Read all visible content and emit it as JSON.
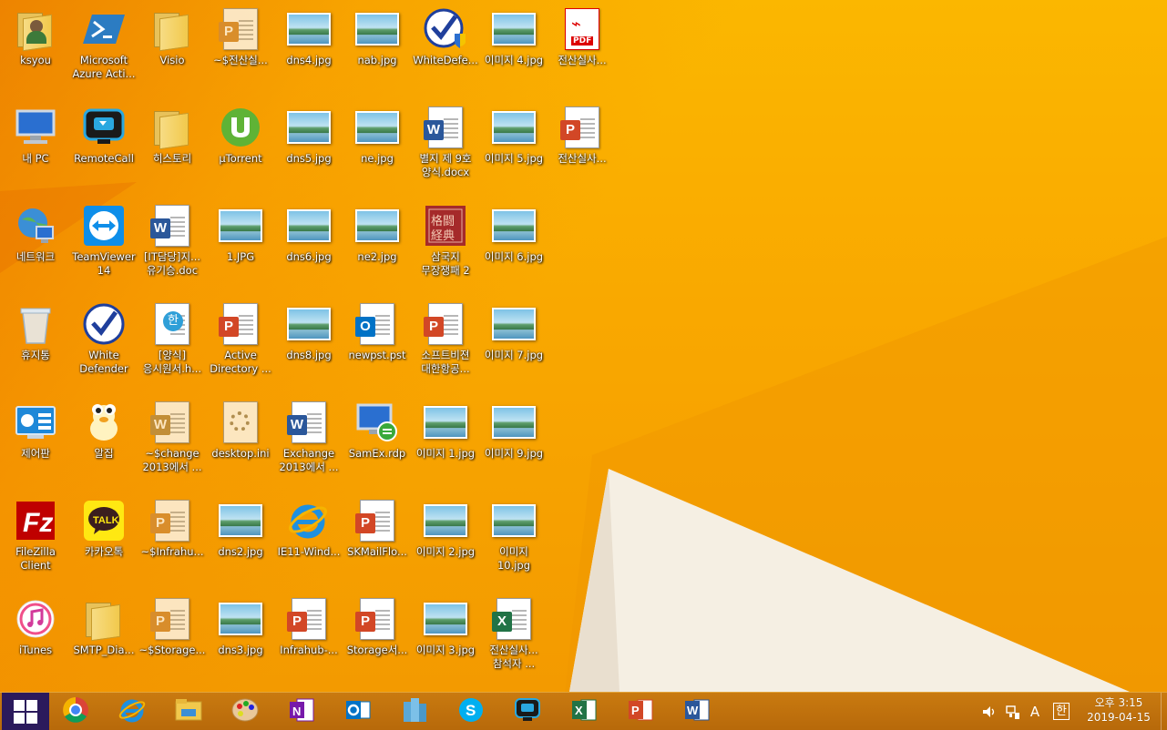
{
  "desktop": {
    "columns": [
      [
        {
          "label": "ksyou",
          "icon": "user-folder-icon"
        },
        {
          "label": "내 PC",
          "icon": "computer-icon"
        },
        {
          "label": "네트워크",
          "icon": "network-icon"
        },
        {
          "label": "휴지통",
          "icon": "recycle-bin-icon"
        },
        {
          "label": "제어판",
          "icon": "control-panel-icon"
        },
        {
          "label": "FileZilla\nClient",
          "icon": "filezilla-icon"
        },
        {
          "label": "iTunes",
          "icon": "itunes-icon"
        }
      ],
      [
        {
          "label": "Microsoft\nAzure Acti...",
          "icon": "powershell-icon"
        },
        {
          "label": "RemoteCall",
          "icon": "remotecall-icon"
        },
        {
          "label": "TeamViewer\n14",
          "icon": "teamviewer-icon"
        },
        {
          "label": "White\nDefender",
          "icon": "white-defender-icon"
        },
        {
          "label": "알집",
          "icon": "alzip-icon"
        },
        {
          "label": "카카오톡",
          "icon": "kakaotalk-icon"
        },
        {
          "label": "SMTP_Dia...",
          "icon": "folder-icon"
        }
      ],
      [
        {
          "label": "Visio",
          "icon": "folder-icon"
        },
        {
          "label": "히스토리",
          "icon": "folder-icon"
        },
        {
          "label": "[IT담당]지...\n유기승.doc",
          "icon": "word-doc-icon"
        },
        {
          "label": "[양식]\n응시원서.h...",
          "icon": "hwp-doc-icon"
        },
        {
          "label": "~$change\n2013에서 ...",
          "icon": "word-temp-icon"
        },
        {
          "label": "~$Infrahu...",
          "icon": "ppt-temp-icon"
        },
        {
          "label": "~$Storage...",
          "icon": "ppt-temp-icon"
        }
      ],
      [
        {
          "label": "~$전산실...",
          "icon": "ppt-temp-icon"
        },
        {
          "label": "µTorrent",
          "icon": "utorrent-icon"
        },
        {
          "label": "1.JPG",
          "icon": "image-file-icon"
        },
        {
          "label": "Active\nDirectory ...",
          "icon": "ppt-doc-icon"
        },
        {
          "label": "desktop.ini",
          "icon": "settings-file-icon"
        },
        {
          "label": "dns2.jpg",
          "icon": "image-file-icon"
        },
        {
          "label": "dns3.jpg",
          "icon": "image-file-icon"
        }
      ],
      [
        {
          "label": "dns4.jpg",
          "icon": "image-file-icon"
        },
        {
          "label": "dns5.jpg",
          "icon": "image-file-icon"
        },
        {
          "label": "dns6.jpg",
          "icon": "image-file-icon"
        },
        {
          "label": "dns8.jpg",
          "icon": "image-file-icon"
        },
        {
          "label": "Exchange\n2013에서 ...",
          "icon": "word-doc-icon"
        },
        {
          "label": "IE11-Wind...",
          "icon": "ie-icon"
        },
        {
          "label": "Infrahub-...",
          "icon": "ppt-doc-icon"
        }
      ],
      [
        {
          "label": "nab.jpg",
          "icon": "image-file-icon"
        },
        {
          "label": "ne.jpg",
          "icon": "image-file-icon"
        },
        {
          "label": "ne2.jpg",
          "icon": "image-file-icon"
        },
        {
          "label": "newpst.pst",
          "icon": "outlook-file-icon"
        },
        {
          "label": "SamEx.rdp",
          "icon": "rdp-icon"
        },
        {
          "label": "SKMailFlo...",
          "icon": "ppt-doc-icon"
        },
        {
          "label": "Storage서...",
          "icon": "ppt-doc-icon"
        }
      ],
      [
        {
          "label": "WhiteDefe...",
          "icon": "white-defender-shield-icon"
        },
        {
          "label": "별지 제 9호\n양식.docx",
          "icon": "word-doc-icon"
        },
        {
          "label": "삼국지\n무장쟁패 2",
          "icon": "game-icon"
        },
        {
          "label": "소프트비젼\n대한항공...",
          "icon": "ppt-doc-icon"
        },
        {
          "label": "이미지 1.jpg",
          "icon": "image-file-icon"
        },
        {
          "label": "이미지 2.jpg",
          "icon": "image-file-icon"
        },
        {
          "label": "이미지 3.jpg",
          "icon": "image-file-icon"
        }
      ],
      [
        {
          "label": "이미지 4.jpg",
          "icon": "image-file-icon"
        },
        {
          "label": "이미지 5.jpg",
          "icon": "image-file-icon"
        },
        {
          "label": "이미지 6.jpg",
          "icon": "image-file-icon"
        },
        {
          "label": "이미지 7.jpg",
          "icon": "image-file-icon"
        },
        {
          "label": "이미지 9.jpg",
          "icon": "image-file-icon"
        },
        {
          "label": "이미지\n10.jpg",
          "icon": "image-file-icon"
        },
        {
          "label": "전산실사...\n참석자 ...",
          "icon": "excel-doc-icon"
        }
      ],
      [
        {
          "label": "전산실사...",
          "icon": "pdf-file-icon"
        },
        {
          "label": "전산실사...",
          "icon": "ppt-doc-icon"
        }
      ]
    ]
  },
  "taskbar": {
    "pinned": [
      "chrome-icon",
      "ie-icon",
      "file-explorer-icon",
      "paint-icon",
      "onenote-icon",
      "outlook-icon",
      "servers-icon",
      "skype-icon",
      "remotecall-icon",
      "excel-icon",
      "powerpoint-icon",
      "word-icon"
    ],
    "tray": {
      "volume_icon": "speaker-icon",
      "network_icon": "network-tray-icon",
      "ime_mode": "A",
      "ime_lang": "한"
    },
    "clock": {
      "time": "오후 3:15",
      "date": "2019-04-15"
    }
  },
  "colors": {
    "wallpaper": "#f9a800",
    "taskbar": "#bf700c",
    "start": "#2b1a5c"
  }
}
